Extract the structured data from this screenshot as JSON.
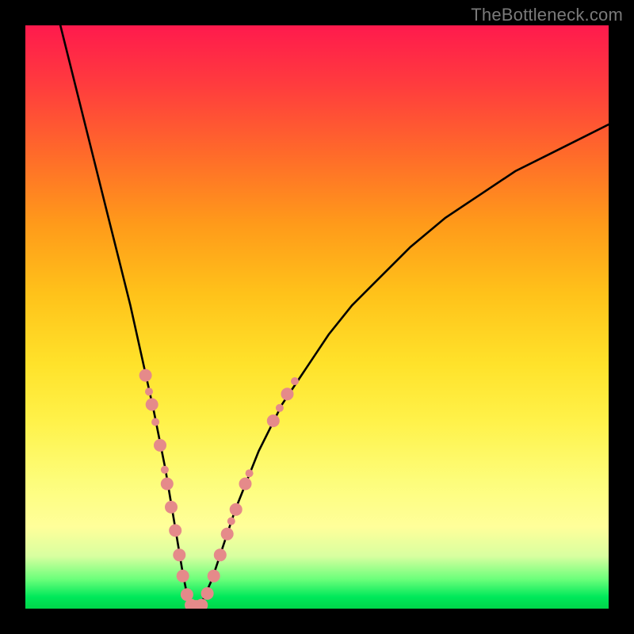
{
  "watermark": "TheBottleneck.com",
  "chart_data": {
    "type": "line",
    "title": "",
    "xlabel": "",
    "ylabel": "",
    "xlim": [
      0,
      100
    ],
    "ylim": [
      0,
      100
    ],
    "legend": false,
    "grid": false,
    "background_gradient": {
      "top": "#ff1a4d",
      "mid": "#ffe22a",
      "bottom": "#00d64a"
    },
    "series": [
      {
        "name": "bottleneck-curve",
        "color": "#000000",
        "x": [
          6,
          8,
          10,
          12,
          14,
          16,
          18,
          20,
          22,
          24,
          25,
          26,
          27,
          28,
          29,
          30,
          32,
          34,
          36,
          38,
          40,
          44,
          48,
          52,
          56,
          60,
          66,
          72,
          78,
          84,
          90,
          96,
          100
        ],
        "y": [
          100,
          92,
          84,
          76,
          68,
          60,
          52,
          43,
          34,
          24,
          18,
          12,
          6,
          1,
          0,
          0.5,
          5,
          11,
          17,
          22,
          27,
          35,
          41,
          47,
          52,
          56,
          62,
          67,
          71,
          75,
          78,
          81,
          83
        ]
      }
    ],
    "markers": {
      "name": "highlighted-points",
      "color": "#e58a8a",
      "radius_primary": 8,
      "radius_secondary": 5,
      "points": [
        {
          "x": 20.6,
          "y": 40.0,
          "r": "primary"
        },
        {
          "x": 21.2,
          "y": 37.2,
          "r": "secondary"
        },
        {
          "x": 21.7,
          "y": 35.0,
          "r": "primary"
        },
        {
          "x": 22.3,
          "y": 32.0,
          "r": "secondary"
        },
        {
          "x": 23.1,
          "y": 28.0,
          "r": "primary"
        },
        {
          "x": 23.9,
          "y": 23.8,
          "r": "secondary"
        },
        {
          "x": 24.3,
          "y": 21.4,
          "r": "primary"
        },
        {
          "x": 25.0,
          "y": 17.4,
          "r": "primary"
        },
        {
          "x": 25.7,
          "y": 13.4,
          "r": "primary"
        },
        {
          "x": 26.4,
          "y": 9.2,
          "r": "primary"
        },
        {
          "x": 27.0,
          "y": 5.6,
          "r": "primary"
        },
        {
          "x": 27.7,
          "y": 2.4,
          "r": "primary"
        },
        {
          "x": 28.4,
          "y": 0.6,
          "r": "primary"
        },
        {
          "x": 29.3,
          "y": 0.4,
          "r": "primary"
        },
        {
          "x": 30.2,
          "y": 0.6,
          "r": "primary"
        },
        {
          "x": 31.2,
          "y": 2.6,
          "r": "primary"
        },
        {
          "x": 32.3,
          "y": 5.6,
          "r": "primary"
        },
        {
          "x": 33.4,
          "y": 9.2,
          "r": "primary"
        },
        {
          "x": 34.6,
          "y": 12.8,
          "r": "primary"
        },
        {
          "x": 35.3,
          "y": 15.0,
          "r": "secondary"
        },
        {
          "x": 36.1,
          "y": 17.0,
          "r": "primary"
        },
        {
          "x": 37.7,
          "y": 21.4,
          "r": "primary"
        },
        {
          "x": 38.4,
          "y": 23.2,
          "r": "secondary"
        },
        {
          "x": 42.5,
          "y": 32.2,
          "r": "primary"
        },
        {
          "x": 43.6,
          "y": 34.4,
          "r": "secondary"
        },
        {
          "x": 44.9,
          "y": 36.8,
          "r": "primary"
        },
        {
          "x": 46.2,
          "y": 39.0,
          "r": "secondary"
        }
      ]
    }
  }
}
